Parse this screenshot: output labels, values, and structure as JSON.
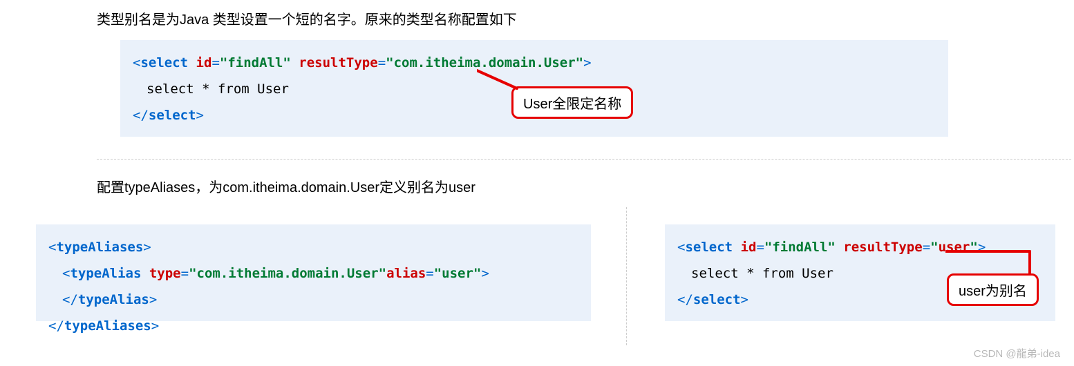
{
  "section1": {
    "desc": "类型别名是为Java 类型设置一个短的名字。原来的类型名称配置如下",
    "code": {
      "open_bracket": "<",
      "select": "select",
      "id_attr": "id",
      "eq1": "=",
      "id_val": "\"findAll\"",
      "space": "  ",
      "resultType_attr": "resultType",
      "eq2": "=",
      "resultType_val": "\"com.itheima.domain.User\"",
      "close_bracket": ">",
      "body": "select * from User",
      "close_open": "</",
      "close_tag": "select",
      "close_end": ">"
    },
    "callout": "User全限定名称"
  },
  "section2": {
    "desc": "配置typeAliases，为com.itheima.domain.User定义别名为user"
  },
  "box_left": {
    "l1_open": "<",
    "l1_tag": "typeAliases",
    "l1_close": ">",
    "l2_open": "<",
    "l2_tag": "typeAlias",
    "l2_sp": " ",
    "l2_type_attr": "type",
    "l2_eq1": "=",
    "l2_type_val": "\"com.itheima.domain.User\"",
    "l2_alias_attr": "alias",
    "l2_eq2": "=",
    "l2_alias_val": "\"user\"",
    "l2_mid": "></",
    "l2_tag2": "typeAlias",
    "l2_end": ">",
    "l3_open": "</",
    "l3_tag": "typeAliases",
    "l3_close": ">"
  },
  "box_right": {
    "open_bracket": "<",
    "select": "select",
    "id_attr": "id",
    "eq1": "=",
    "id_val": "\"findAll\"",
    "space": "  ",
    "resultType_attr": "resultType",
    "eq2": "=",
    "quote_open": "\"",
    "user_val": "user",
    "quote_close": "\"",
    "close_bracket": ">",
    "body": "select * from User",
    "close_open": "</",
    "close_tag": "select",
    "close_end": ">",
    "callout": "user为别名"
  },
  "watermark": "CSDN @龍弟-idea"
}
